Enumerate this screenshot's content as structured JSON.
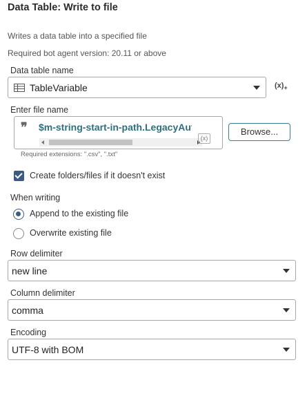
{
  "panel": {
    "title": "Data Table: Write to file",
    "description": "Writes a data table into a specified file",
    "version_note": "Required bot agent version: 20.11 or above"
  },
  "data_table": {
    "label": "Data table name",
    "value": "TableVariable",
    "var_icon": "(x)",
    "var_icon_sub": "+"
  },
  "file": {
    "label": "Enter file name",
    "value": "$m-string-start-in-path.LegacyAutomation$",
    "insert_var_label": "(x)",
    "browse_label": "Browse...",
    "hint": "Required extensions: \".csv\", \".txt\""
  },
  "create_folders": {
    "label": "Create folders/files if it doesn't exist",
    "checked": true
  },
  "when_writing": {
    "label": "When writing",
    "options": [
      {
        "label": "Append to the existing file",
        "selected": true
      },
      {
        "label": "Overwrite existing file",
        "selected": false
      }
    ]
  },
  "row_delimiter": {
    "label": "Row delimiter",
    "value": "new line"
  },
  "column_delimiter": {
    "label": "Column delimiter",
    "value": "comma"
  },
  "encoding": {
    "label": "Encoding",
    "value": "UTF-8 with BOM"
  },
  "colors": {
    "accent": "#3d5a80",
    "variable_text": "#2e6f7f",
    "border": "#a8a8a8"
  }
}
